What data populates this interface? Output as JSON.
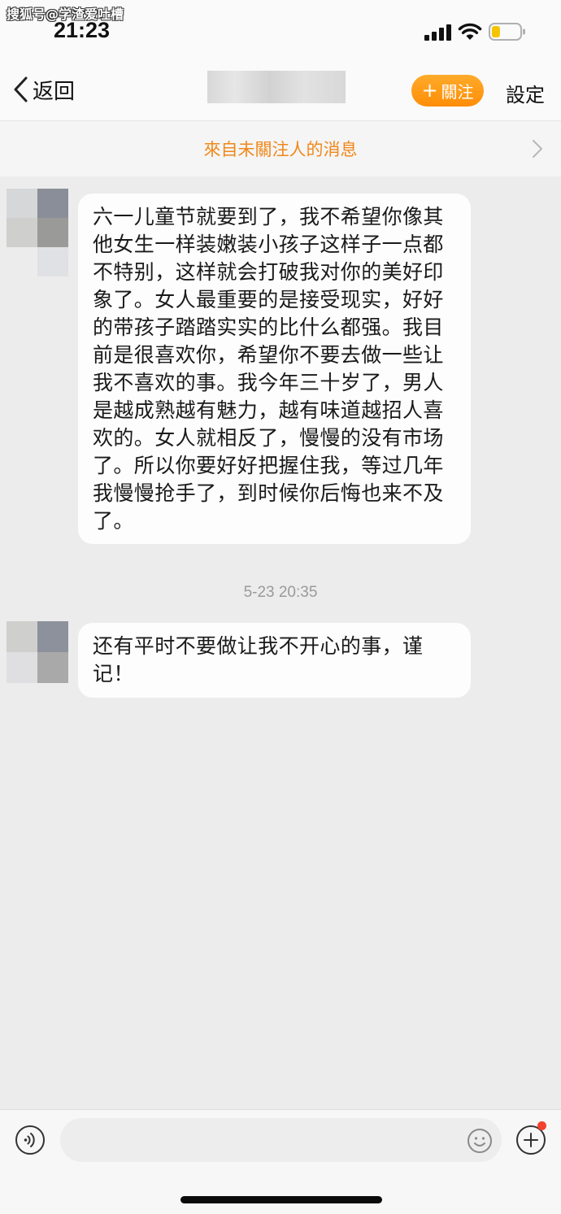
{
  "status_bar": {
    "watermark": "搜狐号@学渣爱吐槽",
    "time": "21:23",
    "battery_level": 0.3
  },
  "nav": {
    "back_label": "返回",
    "follow_label": "關注",
    "settings_label": "設定"
  },
  "notice": {
    "text": "來自未關注人的消息"
  },
  "messages": [
    {
      "text": "六一儿童节就要到了，我不希望你像其他女生一样装嫩装小孩子这样子一点都不特别，这样就会打破我对你的美好印象了。女人最重要的是接受现实，好好的带孩子踏踏实实的比什么都强。我目前是很喜欢你，希望你不要去做一些让我不喜欢的事。我今年三十岁了，男人是越成熟越有魅力，越有味道越招人喜欢的。女人就相反了，慢慢的没有市场了。所以你要好好把握住我，等过几年我慢慢抢手了，到时候你后悔也来不及了。"
    },
    {
      "timestamp": "5-23 20:35",
      "text": "还有平时不要做让我不开心的事，谨记！"
    }
  ],
  "input_bar": {
    "placeholder": ""
  },
  "colors": {
    "accent": "#ff9712",
    "notice_text": "#f0881a",
    "background": "#ececec",
    "bubble": "#fdfdfd",
    "badge": "#f3412d"
  },
  "icons": [
    "signal-icon",
    "wifi-icon",
    "battery-icon",
    "back-chevron-icon",
    "chevron-right-icon",
    "voice-icon",
    "emoji-icon",
    "plus-icon"
  ]
}
